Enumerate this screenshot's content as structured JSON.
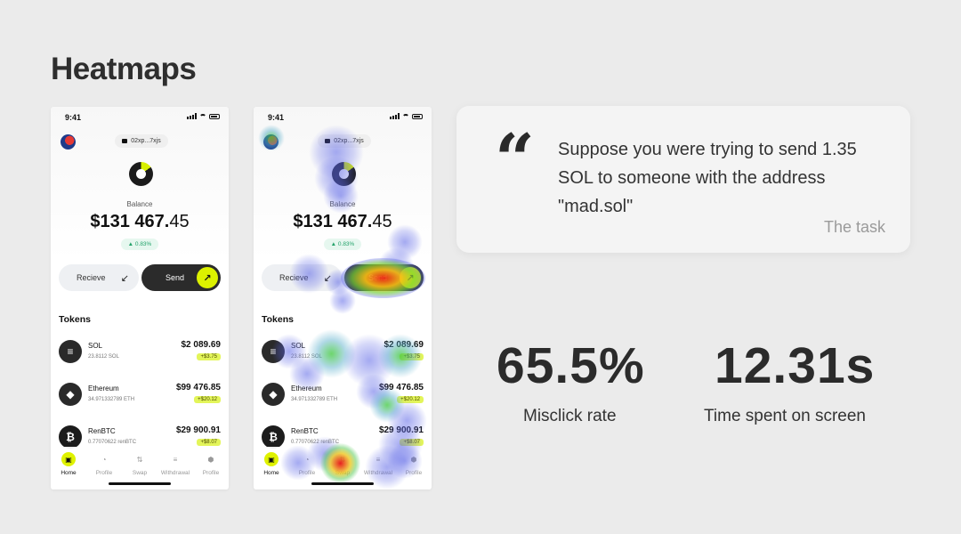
{
  "page": {
    "title": "Heatmaps"
  },
  "phone": {
    "status_time": "9:41",
    "address": "02xp...7xjs",
    "balance_label": "Balance",
    "balance_main": "$131 467.",
    "balance_decimals": "45",
    "balance_change": "▲ 0.83%",
    "receive_label": "Recieve",
    "send_label": "Send",
    "tokens_title": "Tokens",
    "tokens": [
      {
        "name": "SOL",
        "amount": "23.8112 SOL",
        "value": "$2 089.69",
        "change": "+$3.75",
        "icon": "solana-icon",
        "color": "#2a2a2a"
      },
      {
        "name": "Ethereum",
        "amount": "34.971332789 ETH",
        "value": "$99 476.85",
        "change": "+$20.12",
        "icon": "ethereum-icon",
        "color": "#2a2a2a"
      },
      {
        "name": "RenBTC",
        "amount": "0.77070622 renBTC",
        "value": "$29 900.91",
        "change": "+$8.07",
        "icon": "bitcoin-icon",
        "color": "#1c1c1c"
      }
    ],
    "tabs": [
      {
        "label": "Home",
        "icon": "wallet-icon",
        "glyph": "▣",
        "active": true
      },
      {
        "label": "Profile",
        "icon": "pie-chart-icon",
        "glyph": "◔",
        "active": false
      },
      {
        "label": "Swap",
        "icon": "swap-icon",
        "glyph": "⇅",
        "active": false
      },
      {
        "label": "Withdrawal",
        "icon": "stack-icon",
        "glyph": "≡",
        "active": false
      },
      {
        "label": "Profile",
        "icon": "settings-icon",
        "glyph": "⬢",
        "active": false
      }
    ]
  },
  "task": {
    "quote_mark": "“",
    "text": "Suppose you were trying to send 1.35 SOL to someone with the address \"mad.sol\"",
    "caption": "The task"
  },
  "metrics": [
    {
      "value": "65.5%",
      "label": "Misclick rate"
    },
    {
      "value": "12.31s",
      "label": "Time spent on screen"
    }
  ],
  "colors": {
    "accent": "#dcf100",
    "background": "#ebebeb",
    "positive": "#25a36b"
  }
}
